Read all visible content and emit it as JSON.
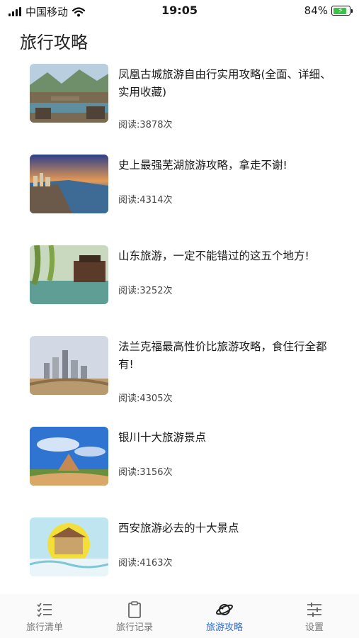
{
  "status": {
    "carrier": "中国移动",
    "time": "19:05",
    "battery": "84%",
    "battery_level": 0.84
  },
  "page": {
    "title": "旅行攻略"
  },
  "articles": [
    {
      "title": "凤凰古城旅游自由行实用攻略(全面、详细、实用收藏)",
      "reads": "阅读:3878次"
    },
    {
      "title": "史上最强芜湖旅游攻略，拿走不谢!",
      "reads": "阅读:4314次"
    },
    {
      "title": "山东旅游，一定不能错过的这五个地方!",
      "reads": "阅读:3252次"
    },
    {
      "title": "法兰克福最高性价比旅游攻略，食住行全都有!",
      "reads": "阅读:4305次"
    },
    {
      "title": "银川十大旅游景点",
      "reads": "阅读:3156次"
    },
    {
      "title": "西安旅游必去的十大景点",
      "reads": "阅读:4163次"
    }
  ],
  "tabs": [
    {
      "label": "旅行清单",
      "icon": "checklist-icon",
      "active": false
    },
    {
      "label": "旅行记录",
      "icon": "clipboard-icon",
      "active": false
    },
    {
      "label": "旅游攻略",
      "icon": "planet-icon",
      "active": true
    },
    {
      "label": "设置",
      "icon": "sliders-icon",
      "active": false
    }
  ],
  "colors": {
    "accent": "#2d6fd9",
    "battery": "#3cc24a"
  }
}
